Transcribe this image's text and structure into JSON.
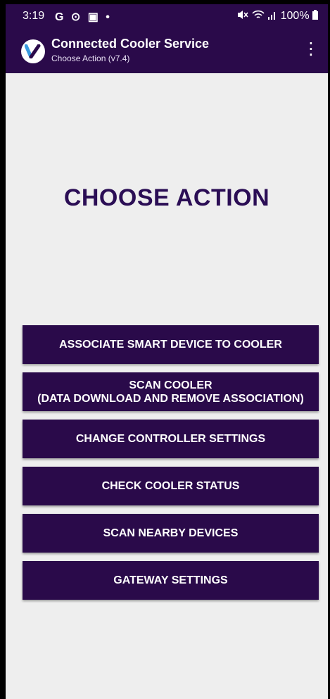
{
  "status_bar": {
    "time": "3:19",
    "left_icons": "G ⊙ ▣ •",
    "right_text": "100%"
  },
  "app_bar": {
    "title": "Connected Cooler Service",
    "subtitle": "Choose Action (v7.4)",
    "menu_icon": "⋮"
  },
  "main": {
    "heading": "CHOOSE ACTION",
    "buttons": [
      {
        "label": "ASSOCIATE SMART DEVICE TO COOLER"
      },
      {
        "label": "SCAN COOLER",
        "label2": "(DATA DOWNLOAD AND REMOVE ASSOCIATION)"
      },
      {
        "label": "CHANGE CONTROLLER SETTINGS"
      },
      {
        "label": "CHECK COOLER STATUS"
      },
      {
        "label": "SCAN NEARBY DEVICES"
      },
      {
        "label": "GATEWAY SETTINGS"
      }
    ]
  },
  "colors": {
    "primary": "#2a0a4a",
    "heading": "#2b0e55",
    "background": "#eeeeee"
  }
}
